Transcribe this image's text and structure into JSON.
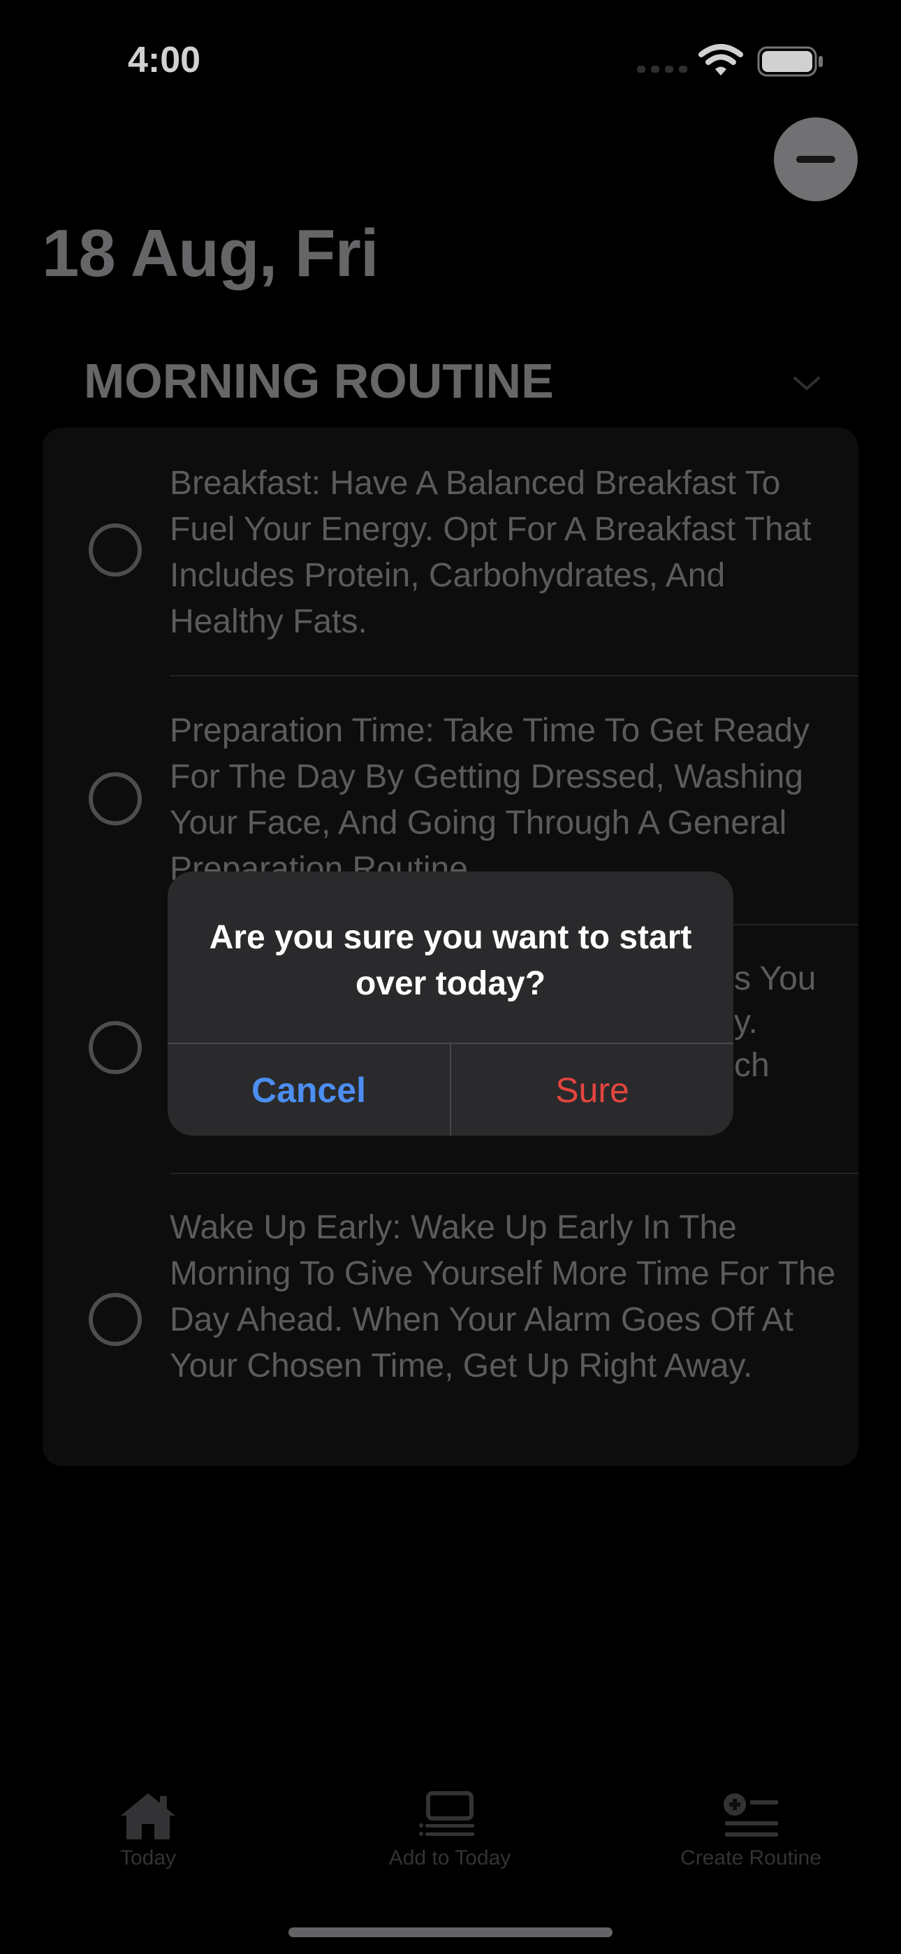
{
  "status_bar": {
    "time": "4:00"
  },
  "header": {
    "date": "18 Aug, Fri"
  },
  "routine": {
    "title": "MORNING ROUTINE",
    "tasks": [
      {
        "text": "Breakfast: Have A Balanced Breakfast To Fuel Your Energy. Opt For A Breakfast That Includes Protein, Carbohydrates, And Healthy Fats."
      },
      {
        "text": "Preparation Time: Take Time To Get Ready For The Day By Getting Dressed, Washing Your Face, And Going Through A General Preparation Routine."
      },
      {
        "text": "s You\ny.\nch"
      },
      {
        "text": "Wake Up Early: Wake Up Early In The Morning To Give Yourself More Time For The Day Ahead. When Your Alarm Goes Off At Your Chosen Time, Get Up Right Away."
      }
    ]
  },
  "tab_bar": {
    "items": [
      {
        "label": "Today",
        "icon": "house-icon"
      },
      {
        "label": "Add to Today",
        "icon": "tray-list-icon"
      },
      {
        "label": "Create Routine",
        "icon": "add-list-icon"
      }
    ]
  },
  "alert": {
    "message": "Are you sure you want to start over today?",
    "cancel_label": "Cancel",
    "confirm_label": "Sure"
  },
  "colors": {
    "background": "#000000",
    "card": "#111112",
    "alert": "#2a2a2c",
    "cancel": "#4c8ef2",
    "destructive": "#e5453f"
  }
}
